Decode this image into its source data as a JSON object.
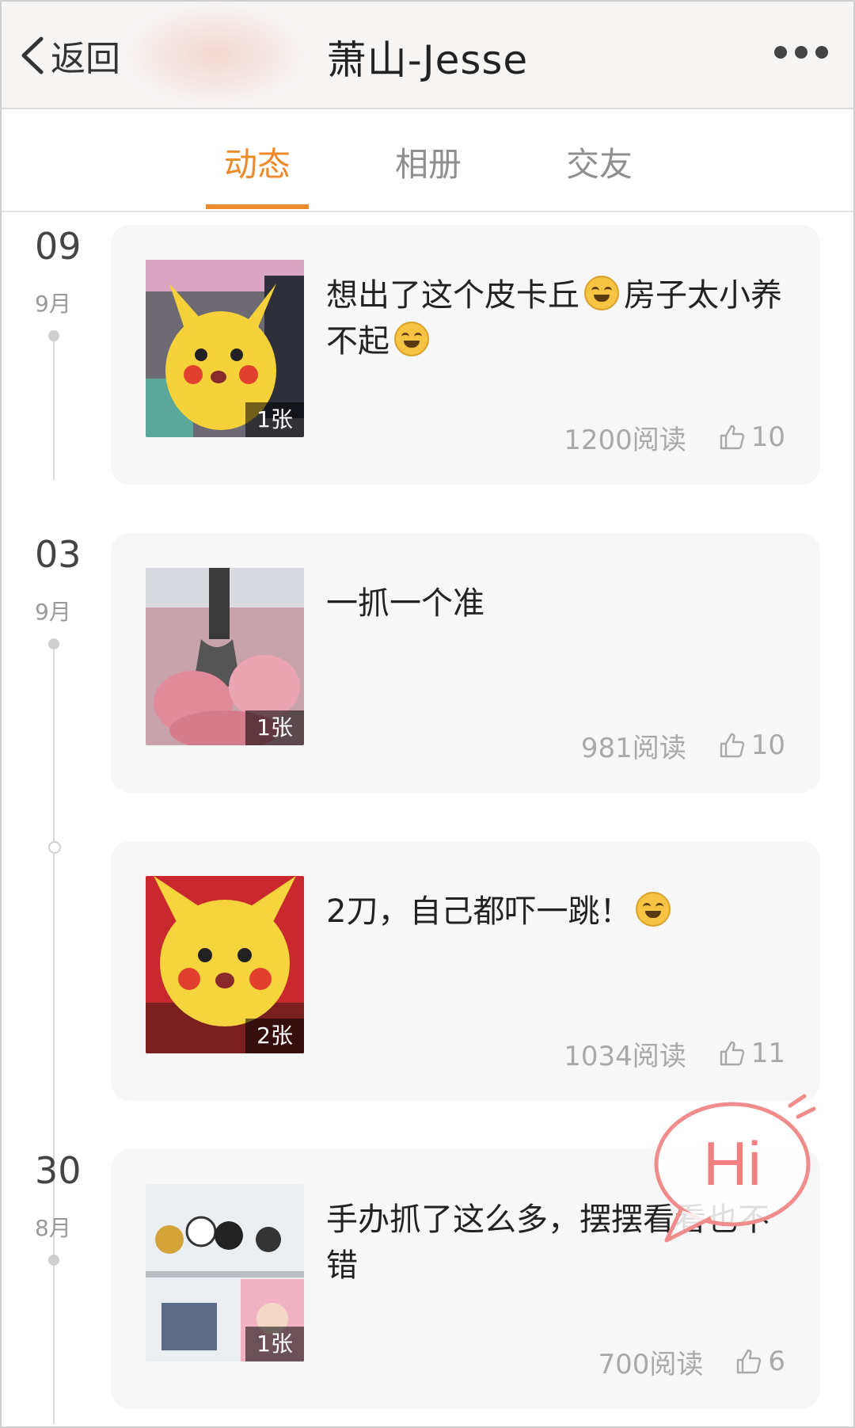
{
  "header": {
    "back_label": "返回",
    "title": "萧山-Jesse"
  },
  "tabs": [
    {
      "label": "动态",
      "active": true
    },
    {
      "label": "相册",
      "active": false
    },
    {
      "label": "交友",
      "active": false
    }
  ],
  "accent_color": "#ec8a2c",
  "posts": [
    {
      "day": "09",
      "month": "9月",
      "text_a": "想出了这个皮卡丘",
      "text_b": "房子太小养不起",
      "image_count": "1张",
      "reads": "1200阅读",
      "likes": "10"
    },
    {
      "day": "03",
      "month": "9月",
      "text": "一抓一个准",
      "image_count": "1张",
      "reads": "981阅读",
      "likes": "10"
    },
    {
      "text": "2刀，自己都吓一跳！",
      "image_count": "2张",
      "reads": "1034阅读",
      "likes": "11"
    },
    {
      "day": "30",
      "month": "8月",
      "text": "手办抓了这么多，摆摆看看也不错",
      "image_count": "1张",
      "reads": "700阅读",
      "likes": "6"
    }
  ],
  "hi_bubble": {
    "label": "Hi"
  },
  "icons": {
    "back": "chevron-left-icon",
    "more": "more-dots-icon",
    "like": "thumbs-up-icon"
  }
}
